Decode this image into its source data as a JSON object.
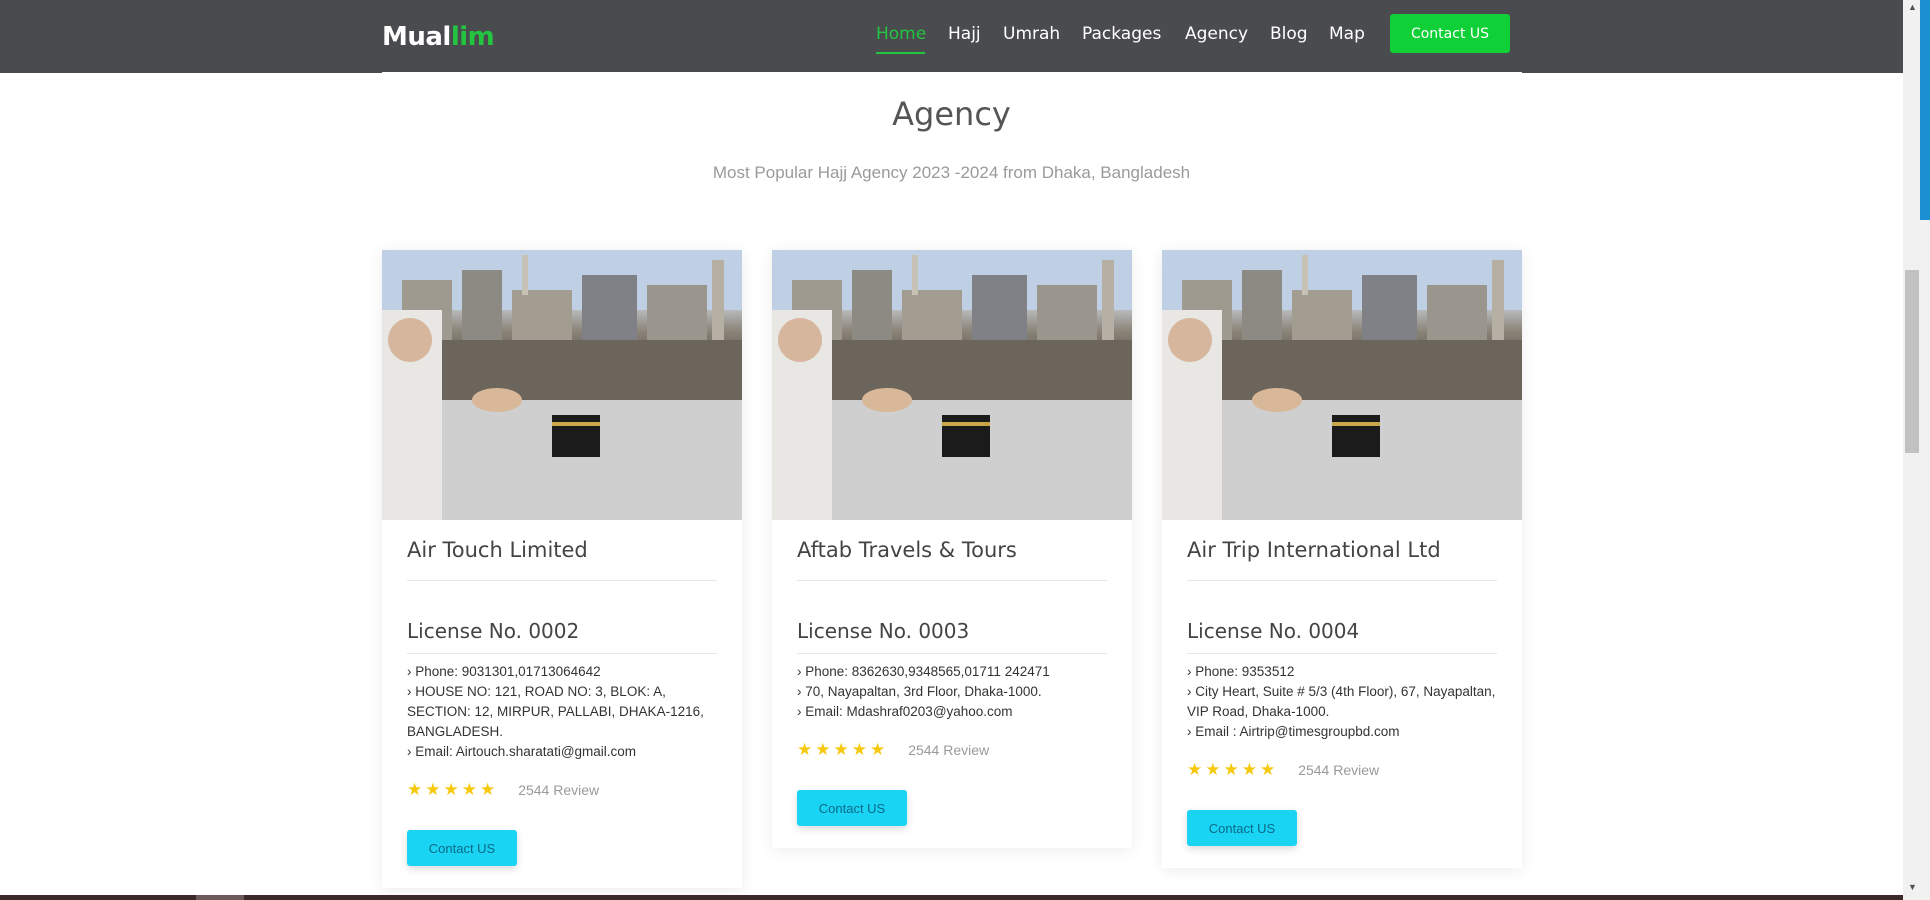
{
  "brand": {
    "part1": "Mual",
    "part2": "lim"
  },
  "nav": {
    "items": [
      {
        "label": "Home",
        "active": true
      },
      {
        "label": "Hajj"
      },
      {
        "label": "Umrah"
      },
      {
        "label": "Packages"
      },
      {
        "label": "Agency"
      },
      {
        "label": "Blog"
      },
      {
        "label": "Map"
      }
    ],
    "contact_label": "Contact US"
  },
  "section": {
    "title": "Agency",
    "subtitle": "Most Popular Hajj Agency 2023 -2024 from Dhaka, Bangladesh"
  },
  "cards": [
    {
      "name": "Air Touch Limited",
      "license": "License No. 0002",
      "phone": "Phone: 9031301,01713064642",
      "address": "HOUSE NO: 121, ROAD NO: 3, BLOK: A, SECTION: 12, MIRPUR, PALLABI, DHAKA-1216, BANGLADESH.",
      "email": "Email: Airtouch.sharatati@gmail.com",
      "stars": "★★★★★",
      "reviews": "2544 Review",
      "button": "Contact US"
    },
    {
      "name": "Aftab Travels & Tours",
      "license": "License No. 0003",
      "phone": "Phone: 8362630,9348565,01711 242471",
      "address": "70, Nayapaltan, 3rd Floor, Dhaka-1000.",
      "email": "Email: Mdashraf0203@yahoo.com",
      "stars": "★★★★★",
      "reviews": "2544 Review",
      "button": "Contact US"
    },
    {
      "name": "Air Trip International Ltd",
      "license": "License No. 0004",
      "phone": "Phone: 9353512",
      "address": "City Heart, Suite # 5/3 (4th Floor), 67, Nayapaltan, VIP Road, Dhaka-1000.",
      "email": "Email : Airtrip@timesgroupbd.com",
      "stars": "★★★★★",
      "reviews": "2544 Review",
      "button": "Contact US"
    }
  ],
  "colors": {
    "accent": "#23c540",
    "navbar": "#4a4b4f",
    "button": "#19d4f2",
    "star": "#f6c90e"
  }
}
